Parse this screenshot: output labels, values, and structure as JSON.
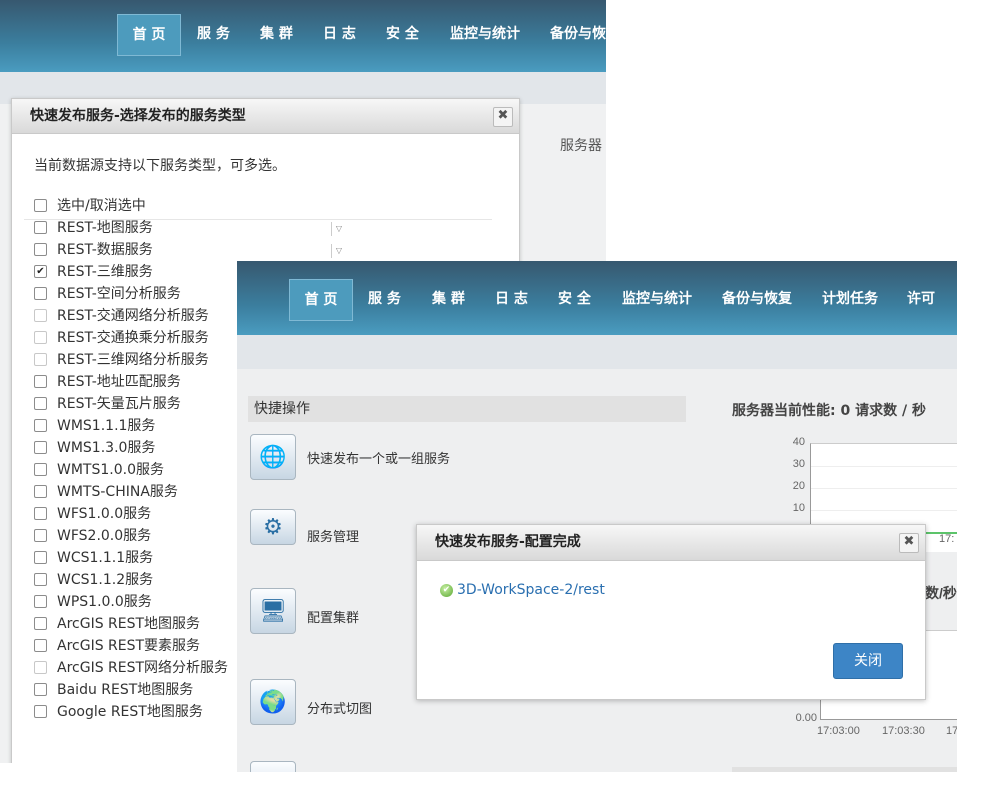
{
  "back": {
    "nav": [
      "首 页",
      "服 务",
      "集 群",
      "日 志",
      "安 全",
      "监控与统计",
      "备份与恢"
    ],
    "perf_label": "服务器",
    "dialog": {
      "title": "快速发布服务-选择发布的服务类型",
      "close_icon": "✖",
      "description": "当前数据源支持以下服务类型，可多选。",
      "select_all": "选中/取消选中",
      "options": [
        {
          "label": "REST-地图服务",
          "state": "unchecked"
        },
        {
          "label": "REST-数据服务",
          "state": "unchecked"
        },
        {
          "label": "REST-三维服务",
          "state": "checked"
        },
        {
          "label": "REST-空间分析服务",
          "state": "unchecked"
        },
        {
          "label": "REST-交通网络分析服务",
          "state": "disabled"
        },
        {
          "label": "REST-交通换乘分析服务",
          "state": "disabled"
        },
        {
          "label": "REST-三维网络分析服务",
          "state": "disabled"
        },
        {
          "label": "REST-地址匹配服务",
          "state": "unchecked"
        },
        {
          "label": "REST-矢量瓦片服务",
          "state": "unchecked"
        },
        {
          "label": "WMS1.1.1服务",
          "state": "unchecked"
        },
        {
          "label": "WMS1.3.0服务",
          "state": "unchecked"
        },
        {
          "label": "WMTS1.0.0服务",
          "state": "unchecked"
        },
        {
          "label": "WMTS-CHINA服务",
          "state": "unchecked"
        },
        {
          "label": "WFS1.0.0服务",
          "state": "unchecked"
        },
        {
          "label": "WFS2.0.0服务",
          "state": "unchecked"
        },
        {
          "label": "WCS1.1.1服务",
          "state": "unchecked"
        },
        {
          "label": "WCS1.1.2服务",
          "state": "unchecked"
        },
        {
          "label": "WPS1.0.0服务",
          "state": "unchecked"
        },
        {
          "label": "ArcGIS REST地图服务",
          "state": "unchecked"
        },
        {
          "label": "ArcGIS REST要素服务",
          "state": "unchecked"
        },
        {
          "label": "ArcGIS REST网络分析服务",
          "state": "disabled"
        },
        {
          "label": "Baidu REST地图服务",
          "state": "unchecked"
        },
        {
          "label": "Google REST地图服务",
          "state": "unchecked"
        }
      ],
      "dropdown_glyph": "▽"
    }
  },
  "front": {
    "nav": [
      "首 页",
      "服 务",
      "集 群",
      "日 志",
      "安 全",
      "监控与统计",
      "备份与恢复",
      "计划任务",
      "许可"
    ],
    "quick_ops_title": "快捷操作",
    "quick_ops": [
      {
        "label": "快速发布一个或一组服务",
        "icon": "globe-publish-icon",
        "glyph": "🌐"
      },
      {
        "label": "服务管理",
        "icon": "gear-window-icon",
        "glyph": "⚙"
      },
      {
        "label": "配置集群",
        "icon": "cluster-computers-icon",
        "glyph": "🖥"
      },
      {
        "label": "分布式切图",
        "icon": "tile-globe-icon",
        "glyph": "🌍"
      }
    ],
    "perf_title": "服务器当前性能:  0 请求数 / 秒",
    "chart_yticks": [
      "40",
      "30",
      "20",
      "10"
    ],
    "chart_partial_x": "17:",
    "chart2_label": "数/秒",
    "chart2_y0": "0.00",
    "chart2_xticks": [
      "17:03:00",
      "17:03:30",
      "17"
    ],
    "dialog": {
      "title": "快速发布服务-配置完成",
      "close_icon": "✖",
      "result": "3D-WorkSpace-2/rest",
      "ok_glyph": "✔",
      "close_button": "关闭"
    }
  }
}
